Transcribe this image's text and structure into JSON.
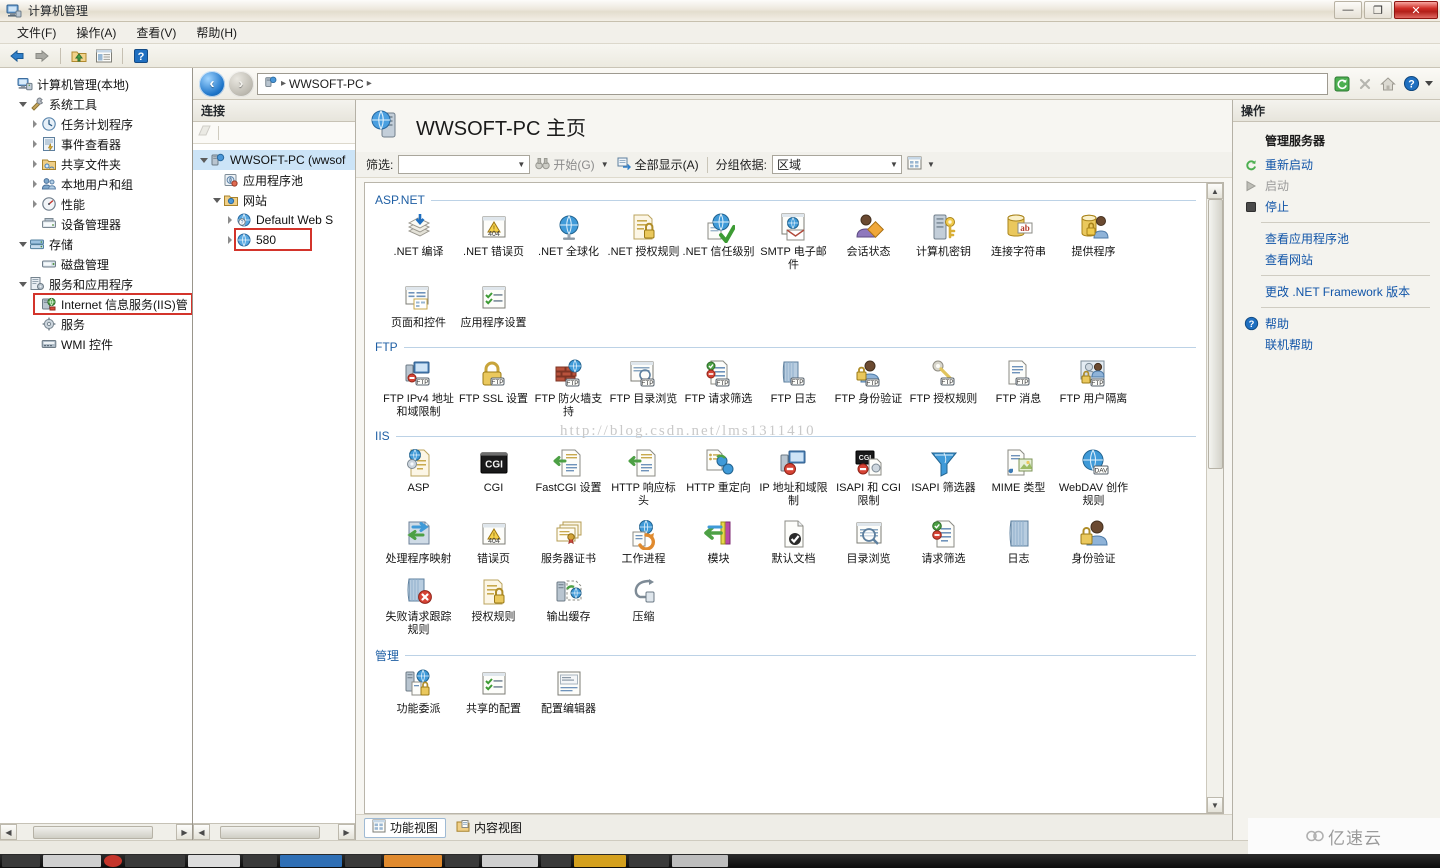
{
  "window": {
    "title": "计算机管理",
    "icon": "computer-management-icon",
    "buttons": {
      "minimize": "—",
      "maximize": "❐",
      "close": "✕"
    }
  },
  "menubar": [
    {
      "label": "文件(F)",
      "name": "menu-file"
    },
    {
      "label": "操作(A)",
      "name": "menu-action"
    },
    {
      "label": "查看(V)",
      "name": "menu-view"
    },
    {
      "label": "帮助(H)",
      "name": "menu-help"
    }
  ],
  "toolbar": {
    "back": "◀",
    "forward": "▶",
    "items": [
      "back-arrow-icon",
      "forward-arrow-icon",
      "up-folder-icon",
      "show-hide-console-tree-icon",
      "help-icon"
    ]
  },
  "mmc_tree": [
    {
      "label": "计算机管理(本地)",
      "indent": 0,
      "twisty": "none",
      "icon": "computer-icon"
    },
    {
      "label": "系统工具",
      "indent": 1,
      "twisty": "open",
      "icon": "system-tools-icon"
    },
    {
      "label": "任务计划程序",
      "indent": 2,
      "twisty": "closed",
      "icon": "task-scheduler-icon"
    },
    {
      "label": "事件查看器",
      "indent": 2,
      "twisty": "closed",
      "icon": "event-viewer-icon"
    },
    {
      "label": "共享文件夹",
      "indent": 2,
      "twisty": "closed",
      "icon": "shared-folders-icon"
    },
    {
      "label": "本地用户和组",
      "indent": 2,
      "twisty": "closed",
      "icon": "local-users-groups-icon"
    },
    {
      "label": "性能",
      "indent": 2,
      "twisty": "closed",
      "icon": "performance-icon"
    },
    {
      "label": "设备管理器",
      "indent": 2,
      "twisty": "none",
      "icon": "device-manager-icon"
    },
    {
      "label": "存储",
      "indent": 1,
      "twisty": "open",
      "icon": "storage-icon"
    },
    {
      "label": "磁盘管理",
      "indent": 2,
      "twisty": "none",
      "icon": "disk-management-icon"
    },
    {
      "label": "服务和应用程序",
      "indent": 1,
      "twisty": "open",
      "icon": "services-apps-icon"
    },
    {
      "label": "Internet 信息服务(IIS)管",
      "indent": 2,
      "twisty": "none",
      "icon": "iis-icon",
      "highlighted": true
    },
    {
      "label": "服务",
      "indent": 2,
      "twisty": "none",
      "icon": "services-icon"
    },
    {
      "label": "WMI 控件",
      "indent": 2,
      "twisty": "none",
      "icon": "wmi-control-icon"
    }
  ],
  "address": {
    "breadcrumb": [
      "WWSOFT-PC"
    ],
    "separator": "▸",
    "icon": "server-icon",
    "right_icons": [
      "refresh-icon",
      "stop-icon",
      "home-icon",
      "help-icon",
      "dropdown-icon"
    ]
  },
  "connections": {
    "header": "连接",
    "toolbar_icons": [
      "connect-icon"
    ],
    "nodes": [
      {
        "label": "WWSOFT-PC (wwsof",
        "indent": 0,
        "twisty": "open",
        "icon": "server-node-icon",
        "selected": true
      },
      {
        "label": "应用程序池",
        "indent": 1,
        "twisty": "none",
        "icon": "app-pools-icon"
      },
      {
        "label": "网站",
        "indent": 1,
        "twisty": "open",
        "icon": "sites-folder-icon"
      },
      {
        "label": "Default Web S",
        "indent": 2,
        "twisty": "closed",
        "icon": "default-site-icon"
      },
      {
        "label": "580",
        "indent": 2,
        "twisty": "closed",
        "icon": "site-icon",
        "highlighted": true
      }
    ]
  },
  "content": {
    "page_title": "WWSOFT-PC 主页",
    "page_icon": "server-home-icon",
    "filterbar": {
      "filter_label": "筛选:",
      "filter_value": "",
      "go_label": "开始(G)",
      "go_accel": "G",
      "showall_label": "全部显示(A)",
      "showall_accel": "A",
      "groupby_label": "分组依据:",
      "groupby_value": "区域",
      "view_icon": "view-mode-icon"
    },
    "groups": [
      {
        "name": "ASP.NET",
        "items": [
          {
            "label": ".NET 编译",
            "icon": "net-compilation-icon"
          },
          {
            "label": ".NET 错误页",
            "icon": "net-error-pages-icon"
          },
          {
            "label": ".NET 全球化",
            "icon": "net-globalization-icon"
          },
          {
            "label": ".NET 授权规则",
            "icon": "net-authorization-rules-icon"
          },
          {
            "label": ".NET 信任级别",
            "icon": "net-trust-levels-icon"
          },
          {
            "label": "SMTP 电子邮件",
            "icon": "smtp-email-icon"
          },
          {
            "label": "会话状态",
            "icon": "session-state-icon"
          },
          {
            "label": "计算机密钥",
            "icon": "machine-key-icon"
          },
          {
            "label": "连接字符串",
            "icon": "connection-strings-icon"
          },
          {
            "label": "提供程序",
            "icon": "providers-icon"
          },
          {
            "label": "页面和控件",
            "icon": "pages-and-controls-icon"
          },
          {
            "label": "应用程序设置",
            "icon": "application-settings-icon"
          }
        ]
      },
      {
        "name": "FTP",
        "items": [
          {
            "label": "FTP IPv4 地址和域限制",
            "icon": "ftp-ipv4-restrictions-icon"
          },
          {
            "label": "FTP SSL 设置",
            "icon": "ftp-ssl-settings-icon"
          },
          {
            "label": "FTP 防火墙支持",
            "icon": "ftp-firewall-support-icon"
          },
          {
            "label": "FTP 目录浏览",
            "icon": "ftp-directory-browsing-icon"
          },
          {
            "label": "FTP 请求筛选",
            "icon": "ftp-request-filtering-icon"
          },
          {
            "label": "FTP 日志",
            "icon": "ftp-logging-icon"
          },
          {
            "label": "FTP 身份验证",
            "icon": "ftp-authentication-icon"
          },
          {
            "label": "FTP 授权规则",
            "icon": "ftp-authorization-rules-icon"
          },
          {
            "label": "FTP 消息",
            "icon": "ftp-messages-icon"
          },
          {
            "label": "FTP 用户隔离",
            "icon": "ftp-user-isolation-icon"
          }
        ]
      },
      {
        "name": "IIS",
        "items": [
          {
            "label": "ASP",
            "icon": "asp-icon"
          },
          {
            "label": "CGI",
            "icon": "cgi-icon"
          },
          {
            "label": "FastCGI 设置",
            "icon": "fastcgi-settings-icon"
          },
          {
            "label": "HTTP 响应标头",
            "icon": "http-response-headers-icon"
          },
          {
            "label": "HTTP 重定向",
            "icon": "http-redirect-icon"
          },
          {
            "label": "IP 地址和域限制",
            "icon": "ip-domain-restrictions-icon"
          },
          {
            "label": "ISAPI 和 CGI 限制",
            "icon": "isapi-cgi-restrictions-icon"
          },
          {
            "label": "ISAPI 筛选器",
            "icon": "isapi-filters-icon"
          },
          {
            "label": "MIME 类型",
            "icon": "mime-types-icon"
          },
          {
            "label": "WebDAV 创作规则",
            "icon": "webdav-authoring-rules-icon"
          },
          {
            "label": "处理程序映射",
            "icon": "handler-mappings-icon"
          },
          {
            "label": "错误页",
            "icon": "error-pages-icon"
          },
          {
            "label": "服务器证书",
            "icon": "server-certificates-icon"
          },
          {
            "label": "工作进程",
            "icon": "worker-processes-icon"
          },
          {
            "label": "模块",
            "icon": "modules-icon"
          },
          {
            "label": "默认文档",
            "icon": "default-document-icon"
          },
          {
            "label": "目录浏览",
            "icon": "directory-browsing-icon"
          },
          {
            "label": "请求筛选",
            "icon": "request-filtering-icon"
          },
          {
            "label": "日志",
            "icon": "logging-icon"
          },
          {
            "label": "身份验证",
            "icon": "authentication-icon"
          },
          {
            "label": "失败请求跟踪规则",
            "icon": "failed-request-tracing-icon"
          },
          {
            "label": "授权规则",
            "icon": "authorization-rules-icon"
          },
          {
            "label": "输出缓存",
            "icon": "output-caching-icon"
          },
          {
            "label": "压缩",
            "icon": "compression-icon"
          }
        ]
      },
      {
        "name": "管理",
        "items": [
          {
            "label": "功能委派",
            "icon": "feature-delegation-icon"
          },
          {
            "label": "共享的配置",
            "icon": "shared-configuration-icon"
          },
          {
            "label": "配置编辑器",
            "icon": "configuration-editor-icon"
          }
        ]
      }
    ],
    "view_tabs": [
      {
        "label": "功能视图",
        "icon": "features-view-icon",
        "selected": true
      },
      {
        "label": "内容视图",
        "icon": "content-view-icon",
        "selected": false
      }
    ]
  },
  "actions": {
    "header": "操作",
    "title": "管理服务器",
    "items": [
      {
        "label": "重新启动",
        "icon": "restart-icon",
        "disabled": false
      },
      {
        "label": "启动",
        "icon": "start-icon",
        "disabled": true
      },
      {
        "label": "停止",
        "icon": "stop-icon",
        "disabled": false
      },
      {
        "sep": true
      },
      {
        "label": "查看应用程序池",
        "icon": "",
        "disabled": false
      },
      {
        "label": "查看网站",
        "icon": "",
        "disabled": false
      },
      {
        "sep": true
      },
      {
        "label": "更改 .NET Framework 版本",
        "icon": "",
        "disabled": false
      },
      {
        "sep": true
      },
      {
        "label": "帮助",
        "icon": "help-icon",
        "disabled": false
      },
      {
        "label": "联机帮助",
        "icon": "",
        "disabled": false
      }
    ]
  },
  "watermarks": {
    "center": "http://blog.csdn.net/lms1311410",
    "bottom_right": "亿速云"
  },
  "colors": {
    "accent_link": "#1155a8",
    "group_header": "#1f5fa4",
    "highlight_box": "#d3342b",
    "selection": "#cce4f7"
  }
}
